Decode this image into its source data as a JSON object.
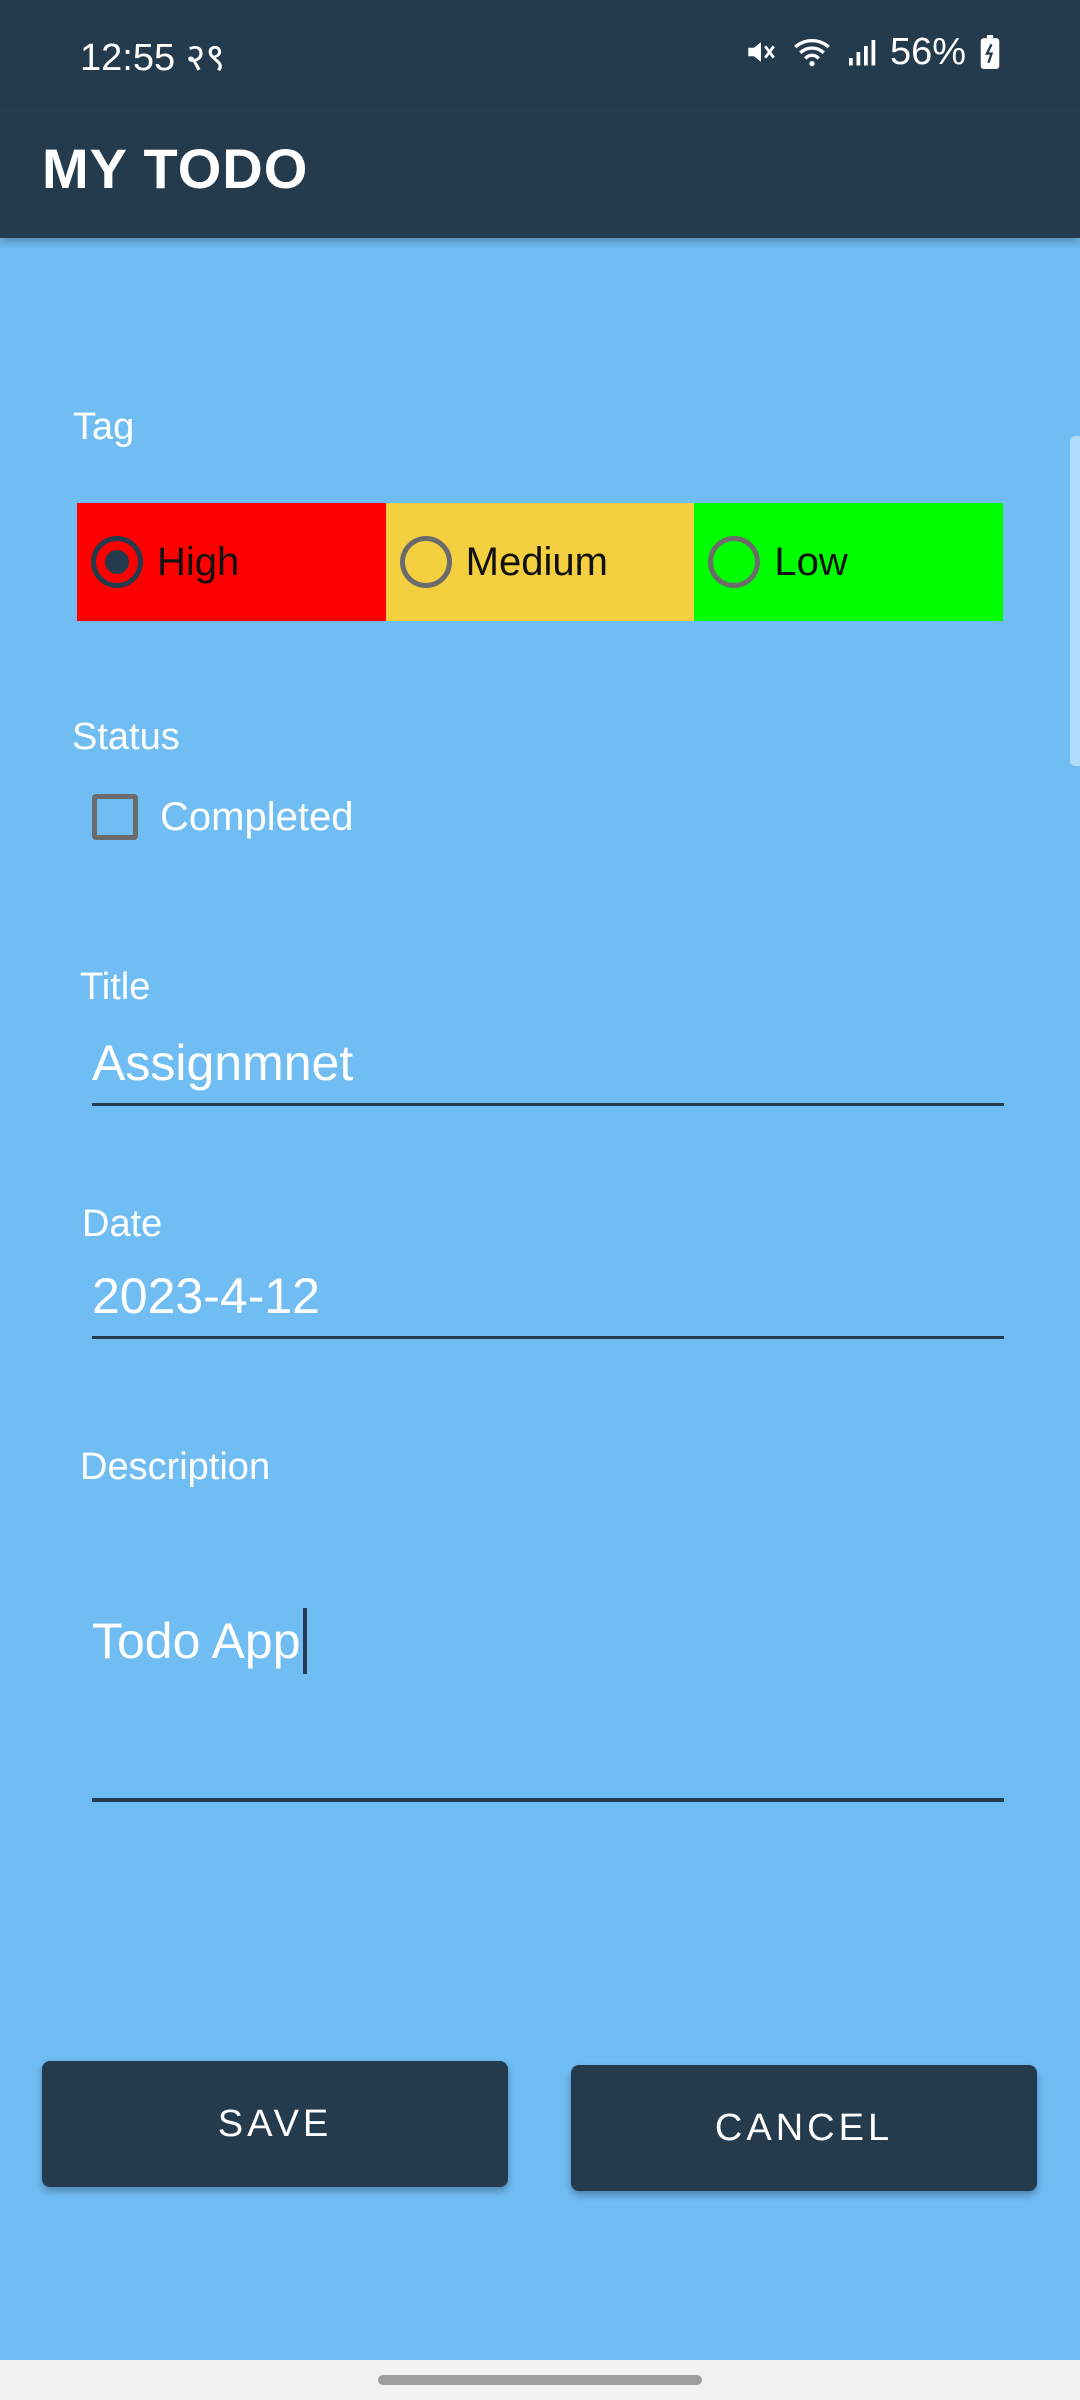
{
  "status_bar": {
    "time": "12:55",
    "extra": "२९",
    "battery": "56%",
    "icons": [
      "mute-icon",
      "wifi-icon",
      "signal-icon",
      "battery-icon"
    ]
  },
  "app_bar": {
    "title": "MY TODO"
  },
  "tag": {
    "label": "Tag",
    "options": [
      {
        "label": "High",
        "color": "#ff0000",
        "checked": true
      },
      {
        "label": "Medium",
        "color": "#f4cf3f",
        "checked": false
      },
      {
        "label": "Low",
        "color": "#00ff00",
        "checked": false
      }
    ]
  },
  "status": {
    "label": "Status",
    "checkbox_label": "Completed",
    "checked": false
  },
  "title_field": {
    "label": "Title",
    "value": "Assignmnet"
  },
  "date_field": {
    "label": "Date",
    "value": "2023-4-12"
  },
  "description_field": {
    "label": "Description",
    "value": "Todo App"
  },
  "buttons": {
    "save": "SAVE",
    "cancel": "CANCEL"
  },
  "colors": {
    "background": "#70bdf4",
    "app_bar": "#243a4d",
    "button": "#243a4d"
  }
}
